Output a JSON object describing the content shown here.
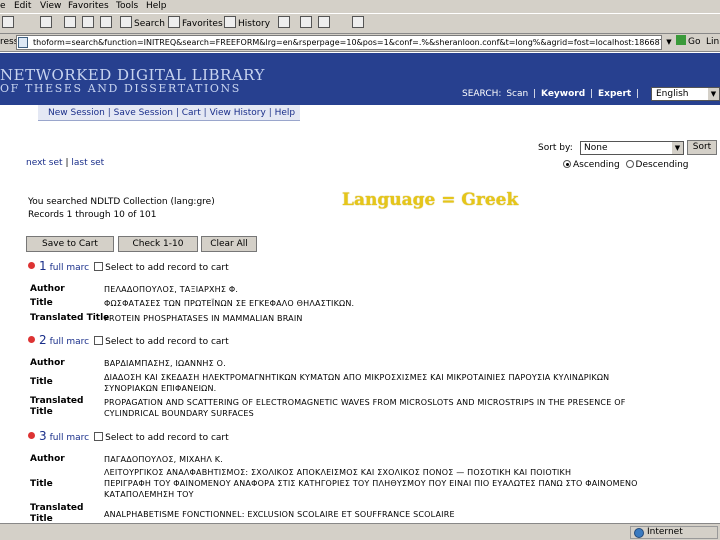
{
  "menu": [
    "e",
    "Edit",
    "View",
    "Favorites",
    "Tools",
    "Help"
  ],
  "toolbar": {
    "search": "Search",
    "favorites": "Favorites",
    "history": "History"
  },
  "address": {
    "label": "ress",
    "url": "thoform=search&function=INITREQ&search=FREEFORM&lrg=en&rsperpage=10&pos=1&conf=.%&sheranloon.conf&t=long%&agrid=fost=localhost:18668TDE-AU:T",
    "go": "Go",
    "links": "Lin"
  },
  "banner": {
    "logo_line1": "NETWORKED DIGITAL LIBRARY",
    "logo_line2": "OF THESES AND DISSERTATIONS",
    "modes": [
      "SEARCH:",
      "Scan",
      "|",
      "Keyword",
      "|",
      "Expert",
      "|"
    ],
    "language": "English"
  },
  "subnav": [
    "New Session",
    "|",
    "Save Session",
    "|",
    "Cart",
    "|",
    "View History",
    "|",
    "Help"
  ],
  "nav": {
    "next": "next set",
    "sep": "|",
    "last": "last set"
  },
  "sort": {
    "label": "Sort by:",
    "value": "None",
    "button": "Sort",
    "ascending": "Ascending",
    "descending": "Descending"
  },
  "summary": {
    "line1": "You searched NDLTD Collection   (lang:gre)",
    "line2": "Records 1 through 10 of 101"
  },
  "overlay": "Language = Greek",
  "actions": [
    "Save to Cart",
    "Check 1-10",
    "Clear All"
  ],
  "records": [
    {
      "num": "1",
      "full": "full marc",
      "select": "Select to add record to cart",
      "fields": [
        {
          "label": "Author",
          "value": "ΠΕΛΑΔΟΠΟΥΛΟΣ, ΤΑΞΙΑΡΧΗΣ Φ."
        },
        {
          "label": "Title",
          "value": "ΦΩΣΦΑΤΑΣΕΣ ΤΩΝ ΠΡΩΤΕΪΝΩΝ ΣΕ ΕΓΚΕΦΑΛΟ ΘΗΛΑΣΤΙΚΩΝ."
        },
        {
          "label": "Translated Title",
          "value": "PROTEIN PHOSPHATASES IN MAMMALIAN BRAIN"
        }
      ]
    },
    {
      "num": "2",
      "full": "full marc",
      "select": "Select to add record to cart",
      "fields": [
        {
          "label": "Author",
          "value": "ΒΑΡΔΙΑΜΠΑΣΗΣ, ΙΩΑΝΝΗΣ Ο."
        },
        {
          "label": "Title",
          "value": "ΔΙΑΔΟΣΗ ΚΑΙ ΣΚΕΔΑΣΗ ΗΛΕΚΤΡΟΜΑΓΝΗΤΙΚΩΝ ΚΥΜΑΤΩΝ ΑΠΟ ΜΙΚΡΟΣΧΙΣΜΕΣ ΚΑΙ ΜΙΚΡΟΤΑΙΝΙΕΣ ΠΑΡΟΥΣΙΑ ΚΥΛΙΝΔΡΙΚΩΝ",
          "value2": "ΣΥΝΟΡΙΑΚΩΝ ΕΠΙΦΑΝΕΙΩΝ."
        },
        {
          "label": "Translated Title",
          "value": "PROPAGATION AND SCATTERING OF ELECTROMAGNETIC WAVES FROM MICROSLOTS AND MICROSTRIPS IN THE PRESENCE OF",
          "value2": "CYLINDRICAL BOUNDARY SURFACES"
        }
      ]
    },
    {
      "num": "3",
      "full": "full marc",
      "select": "Select to add record to cart",
      "fields": [
        {
          "label": "Author",
          "value": "ΠΑΓΑΔΟΠΟΥΛΟΣ, ΜΙΧΑΗΛ Κ."
        },
        {
          "label": "Title",
          "value": "ΛΕΙΤΟΥΡΓΙΚΟΣ ΑΝΑΛΦΑΒΗΤΙΣΜΟΣ: ΣΧΟΛΙΚΟΣ ΑΠΟΚΛΕΙΣΜΟΣ ΚΑΙ ΣΧΟΛΙΚΟΣ ΠΟΝΟΣ — ΠΟΣΟΤΙΚΗ ΚΑΙ ΠΟΙΟΤΙΚΗ",
          "value2": "ΠΕΡΙΓΡΑΦΗ ΤΟΥ ΦΑΙΝΟΜΕΝΟΥ ΑΝΑΦΟΡΑ ΣΤΙΣ ΚΑΤΗΓΟΡΙΕΣ ΤΟΥ ΠΛΗΘΥΣΜΟΥ ΠΟΥ ΕΙΝΑΙ ΠΙΟ ΕΥΑΛΩΤΕΣ ΠΑΝΩ ΣΤΟ ΦΑΙΝΟΜΕΝΟ",
          "value3": "ΚΑΤΑΠΟΛΕΜΗΣΗ ΤΟΥ"
        },
        {
          "label": "Translated Title",
          "value": "ANALPHABETISME FONCTIONNEL: EXCLUSION SCOLAIRE ET SOUFFRANCE SCOLAIRE"
        }
      ]
    }
  ],
  "status": {
    "zone": "Internet"
  },
  "colors": {
    "banner": "#27408f",
    "chrome": "#d4d0c8",
    "link": "#1a2f8a",
    "overlay": "#e6c619",
    "dot": "#dd3333"
  }
}
